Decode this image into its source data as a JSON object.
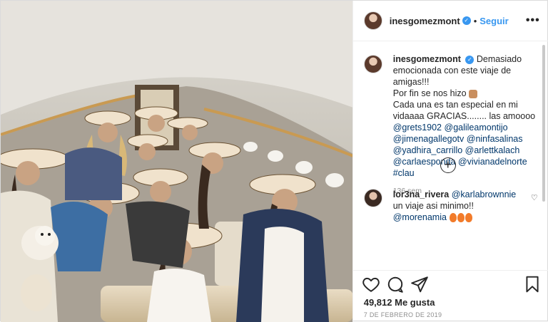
{
  "post": {
    "username": "inesgomezmont",
    "separator": "•",
    "follow_label": "Seguir",
    "more_label": "•••",
    "verified_glyph": "✓"
  },
  "caption": {
    "username": "inesgomezmont",
    "lines": [
      "Demasiado emocionada con este viaje de amigas!!!",
      "Por fin se nos hizo",
      "Cada una es tan especial en mi vidaaaa GRACIAS........ las amoooo"
    ],
    "tags": [
      "@grets1902",
      "@galileamontijo",
      "@jimenagallegotv",
      "@ninfasalinas",
      "@yadhira_carrillo",
      "@arlettkalach",
      "@carlaesponda",
      "@vivianadelnorte",
      "#clau"
    ],
    "time": "136 sem",
    "pray_emoji": "folded-hands-emoji"
  },
  "load_more": {
    "icon": "plus-circle-icon",
    "glyph": "+"
  },
  "comment": {
    "username": "lor3na_rivera",
    "mention": "@karlabrownnie",
    "text": "un viaje asi minimo!!",
    "mention2": "@morenamia",
    "emoji": "fire-emoji"
  },
  "actions": {
    "likes_count": "49,812",
    "likes_label": "Me gusta",
    "date": "7 de febrero de 2019"
  },
  "colors": {
    "link": "#3897f0",
    "tag": "#00376b",
    "muted": "#8e8e8e",
    "border": "#dbdbdb"
  }
}
